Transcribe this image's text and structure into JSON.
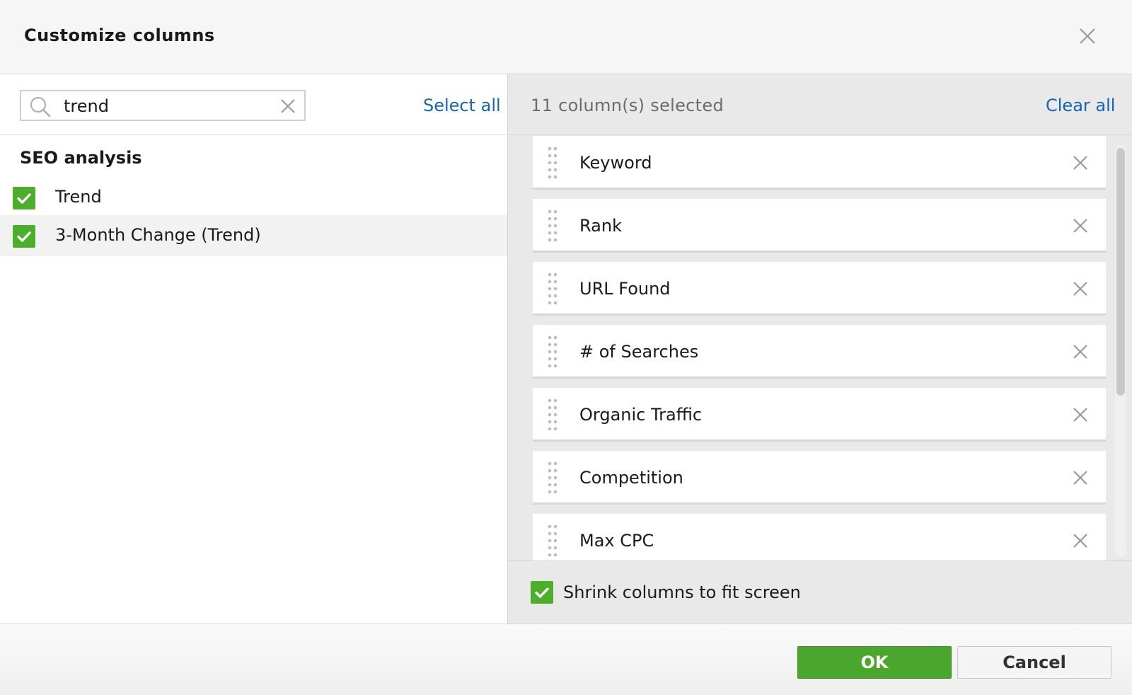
{
  "dialog": {
    "title": "Customize columns"
  },
  "left": {
    "search": {
      "value": "trend",
      "placeholder": ""
    },
    "select_all": "Select all",
    "group": {
      "title": "SEO analysis",
      "options": [
        {
          "label": "Trend",
          "checked": true
        },
        {
          "label": "3-Month Change (Trend)",
          "checked": true
        }
      ]
    }
  },
  "right": {
    "selected_count": "11 column(s) selected",
    "clear_all": "Clear all",
    "columns": [
      "Keyword",
      "Rank",
      "URL Found",
      "# of Searches",
      "Organic Traffic",
      "Competition",
      "Max CPC"
    ],
    "shrink_label": "Shrink columns to fit screen",
    "shrink_checked": true
  },
  "footer": {
    "ok": "OK",
    "cancel": "Cancel"
  },
  "colors": {
    "accent_green": "#4caf2a",
    "link_blue": "#1565b3"
  }
}
